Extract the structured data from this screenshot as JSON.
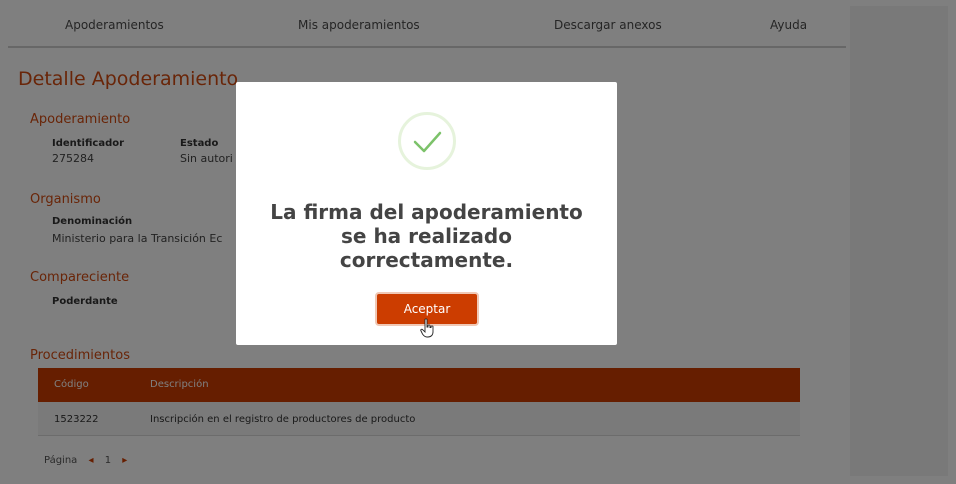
{
  "nav": {
    "items": [
      "Apoderamientos",
      "Mis apoderamientos",
      "Descargar anexos",
      "Ayuda"
    ]
  },
  "page": {
    "title": "Detalle Apoderamiento"
  },
  "apoderamiento": {
    "title": "Apoderamiento",
    "identificador_label": "Identificador",
    "identificador_value": "275284",
    "estado_label": "Estado",
    "estado_value": "Sin autori"
  },
  "organismo": {
    "title": "Organismo",
    "denominacion_label": "Denominación",
    "denominacion_value": "Ministerio para la Transición Ec"
  },
  "compareciente": {
    "title": "Compareciente",
    "poderdante_label": "Poderdante"
  },
  "procedimientos": {
    "title": "Procedimientos",
    "columns": [
      "Código",
      "Descripción"
    ],
    "rows": [
      {
        "codigo": "1523222",
        "descripcion": "Inscripción en el registro de productores de producto"
      }
    ],
    "pager_label": "Página",
    "pager_page": "1"
  },
  "modal": {
    "message": "La firma del apoderamiento se ha realizado correctamente.",
    "accept_label": "Aceptar"
  },
  "colors": {
    "accent": "#d24a10",
    "table_header": "#cc3d00",
    "check": "#7cc26a"
  },
  "icons": {
    "success": "check-icon",
    "cursor": "hand-pointer-icon",
    "pager_prev": "triangle-left-icon",
    "pager_next": "triangle-right-icon"
  }
}
